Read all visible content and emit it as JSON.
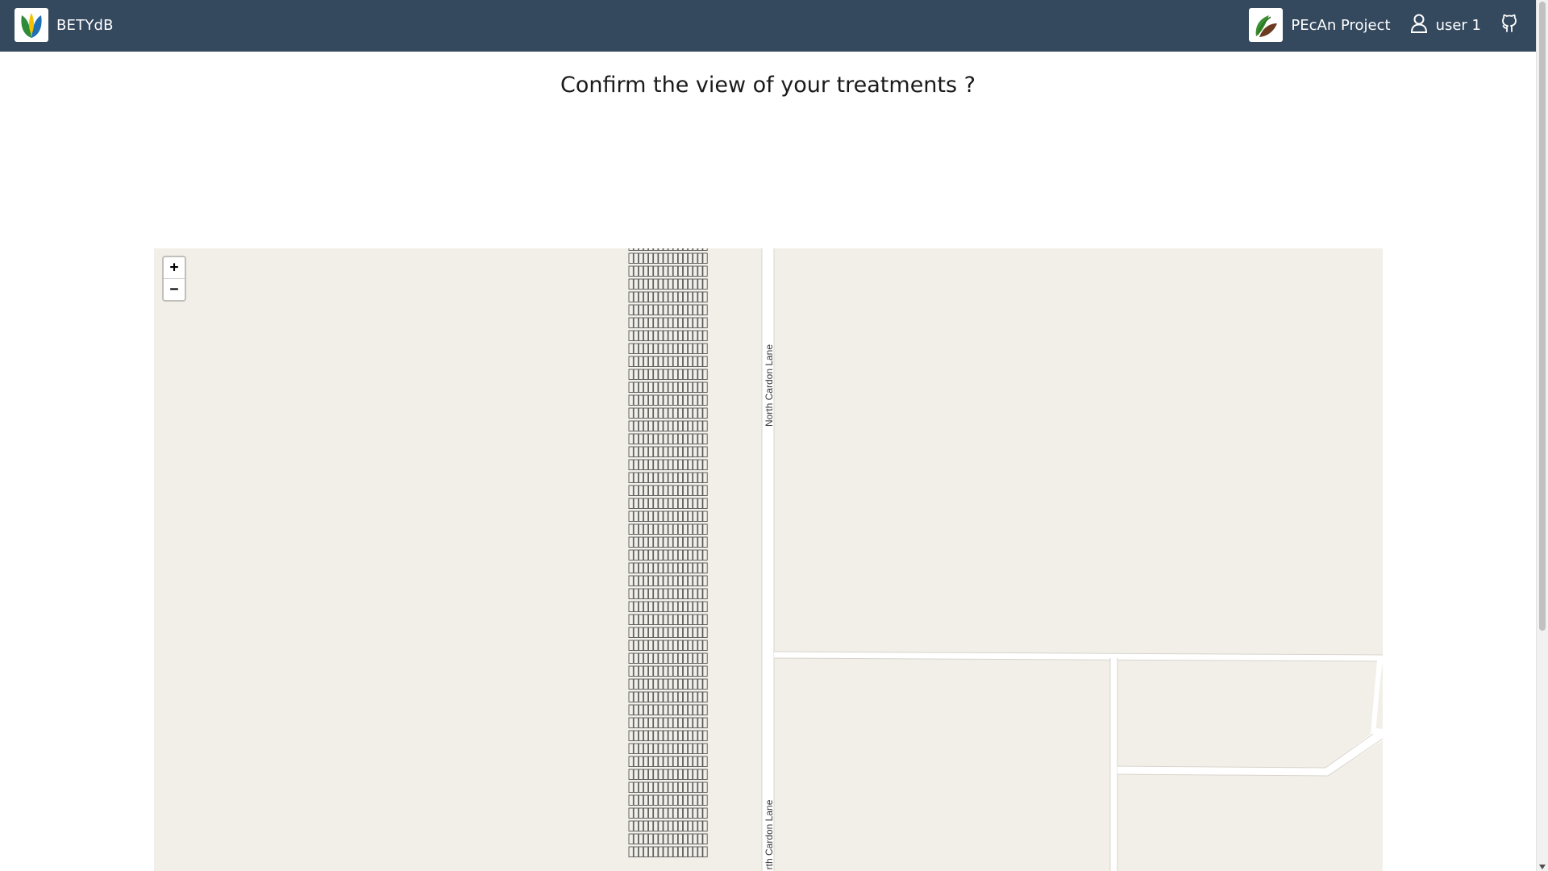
{
  "navbar": {
    "brand": "BETYdB",
    "project_label": "PEcAn Project",
    "user_label": "user 1",
    "github_icon": "github-icon"
  },
  "page": {
    "title": "Confirm the view of your treatments ?"
  },
  "map": {
    "zoom_in_label": "+",
    "zoom_out_label": "−",
    "road_label": "North Cardon Lane",
    "road_label_partial": "rth Cardon Lane"
  },
  "colors": {
    "navbar": "#34495e",
    "map_land": "#f2efe9",
    "road": "#ffffff",
    "plot_outline": "#555555"
  }
}
